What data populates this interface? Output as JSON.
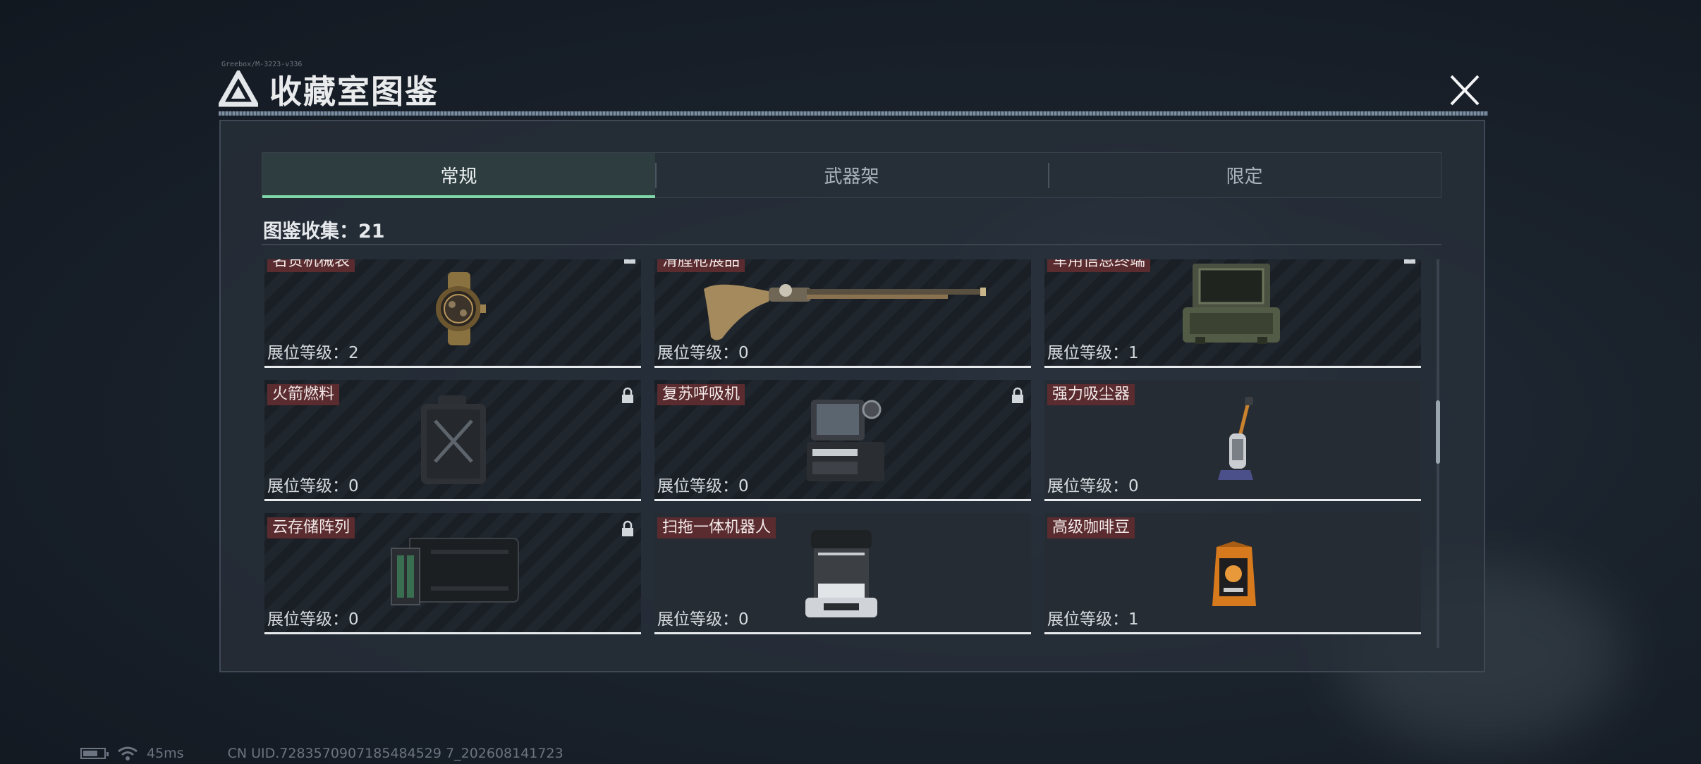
{
  "header": {
    "title": "收藏室图鉴",
    "tiny_code": "Greebox/M-3223-v336"
  },
  "tabs": [
    {
      "label": "常规",
      "active": true
    },
    {
      "label": "武器架",
      "active": false
    },
    {
      "label": "限定",
      "active": false
    }
  ],
  "collection": {
    "label": "图鉴收集：21"
  },
  "level_label": "展位等级：",
  "items": [
    {
      "name": "名贵机械表",
      "level": "2",
      "icon": "watch",
      "marker": "dropdown"
    },
    {
      "name": "滑膛枪展品",
      "level": "0",
      "icon": "musket",
      "marker": "none"
    },
    {
      "name": "军用信息终端",
      "level": "1",
      "icon": "field-terminal",
      "marker": "dropdown"
    },
    {
      "name": "火箭燃料",
      "level": "0",
      "icon": "fuel-can",
      "marker": "lock"
    },
    {
      "name": "复苏呼吸机",
      "level": "0",
      "icon": "ventilator",
      "marker": "lock"
    },
    {
      "name": "强力吸尘器",
      "level": "0",
      "icon": "vacuum",
      "marker": "none"
    },
    {
      "name": "云存储阵列",
      "level": "0",
      "icon": "storage-array",
      "marker": "lock"
    },
    {
      "name": "扫拖一体机器人",
      "level": "0",
      "icon": "robot-station",
      "marker": "none"
    },
    {
      "name": "高级咖啡豆",
      "level": "1",
      "icon": "coffee-bag",
      "marker": "none"
    }
  ],
  "status_bar": {
    "ping": "45ms",
    "uid": "CN UID.7283570907185484529 7_202608141723"
  },
  "colors": {
    "accent": "#7fd6a8",
    "name_tag": "#5a2b2f",
    "panel": "#28303a"
  }
}
